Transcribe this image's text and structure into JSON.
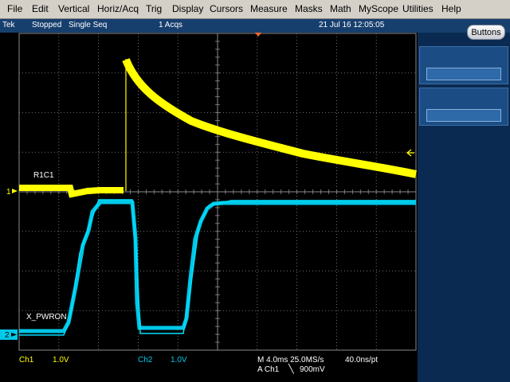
{
  "menu": [
    "File",
    "Edit",
    "Vertical",
    "Horiz/Acq",
    "Trig",
    "Display",
    "Cursors",
    "Measure",
    "Masks",
    "Math",
    "MyScope",
    "Utilities",
    "Help"
  ],
  "status": {
    "brand": "Tek",
    "state": "Stopped",
    "mode": "Single Seq",
    "acqs": "1 Acqs",
    "datetime": "21 Jul 16 12:05:05"
  },
  "buttons_label": "Buttons",
  "channels": {
    "ch1": {
      "label": "R1C1",
      "marker": "1",
      "name": "Ch1",
      "scale": "1.0V",
      "color": "#ffff00"
    },
    "ch2": {
      "label": "X_PWRON",
      "marker": "2",
      "name": "Ch2",
      "scale": "1.0V",
      "color": "#00c8e8"
    }
  },
  "horizontal": {
    "scale_line": "M 4.0ms 25.0MS/s",
    "resolution": "40.0ns/pt",
    "trigger_source": "A  Ch1",
    "trigger_slope_icon": "falling-edge-icon",
    "trigger_level": "900mV"
  },
  "icons": {
    "trigger_position": "trigger-position-icon",
    "trigger_level": "trigger-level-icon"
  },
  "colors": {
    "grid": "#8c8c8c",
    "status_bg": "#173f6e",
    "panel_bg": "#0a2a52"
  }
}
